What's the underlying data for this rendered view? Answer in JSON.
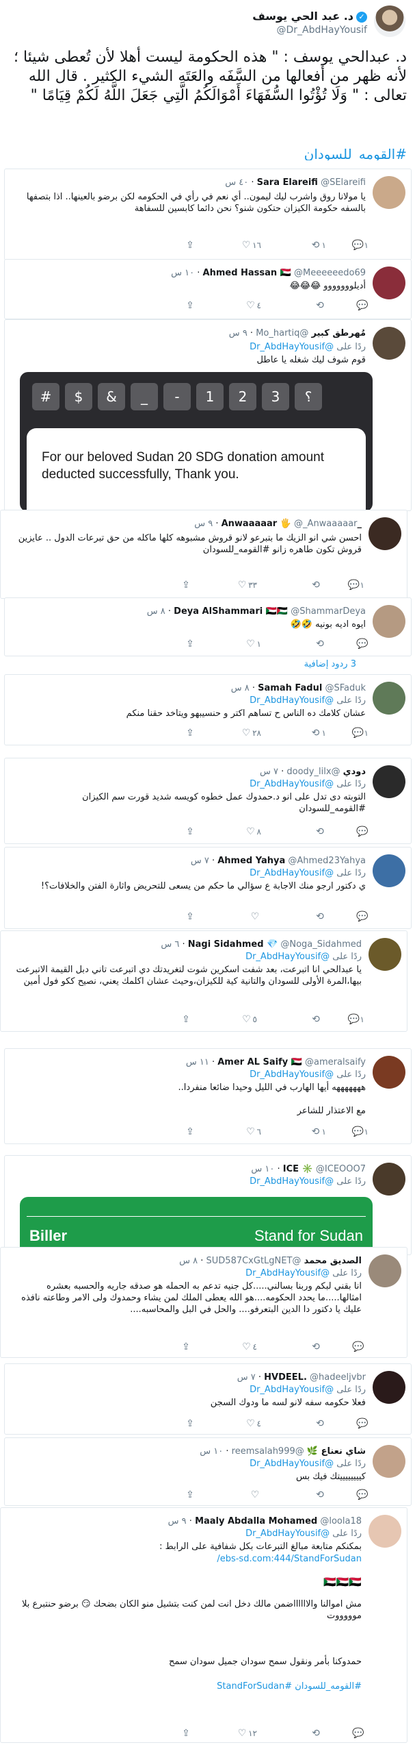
{
  "main": {
    "name": "د. عبد الحي يوسف",
    "handle": "@Dr_AbdHayYousif",
    "text": "د. عبدالحي يوسف : \" هذه الحكومة ليست أهلا لأن تُعطى شيئا ؛ لأنه ظهر من أفعالها من السَّفَه والعَتَه الشيء الكثير . قال الله تعالى : \" وَلَا تُؤْتُوا السُّفَهَاءَ أَمْوَالَكُمُ الَّتِي جَعَلَ اللَّهُ لَكُمْ قِيَامًا \"",
    "hashtag": "#القومه_للسودان"
  },
  "common": {
    "replying_prefix": "ردًا على",
    "mention": "@Dr_AbdHayYousif",
    "more_replies": "3 ردود إضافية"
  },
  "replies": [
    {
      "name": "Sara Elareifi",
      "handle": "@SElareifi",
      "time": "٤٠ س",
      "body": "يا مولانا روق واشرب ليك ليمون.. أي نعم في رأي في الحكومه لكن برضو بالعينها.. اذا بتصفها بالسفه حكومة الكيزان حتكون شنو؟ نحن دائما كابسين للسفاهة",
      "reply": "١",
      "retweet": "١",
      "like": "١٦"
    },
    {
      "name": "Ahmed Hassan 🇸🇩",
      "handle": "@Meeeeeedo69",
      "time": "١٠ س",
      "body": "أديلووووووو 😂😂😂",
      "reply": "",
      "retweet": "",
      "like": "٤"
    },
    {
      "name": "مُهرطق كبير",
      "handle": "@Mo_hartiq",
      "time": "٩ س",
      "body": "قوم شوف ليك شغله يا عاطل",
      "media_caption": "For our beloved Sudan 20 SDG donation amount deducted successfully, Thank you.",
      "keys": [
        "#",
        "$",
        "&",
        "_",
        "-",
        "1",
        "2",
        "3",
        "؟"
      ]
    },
    {
      "name": "_Anwaaaaar 🖐",
      "handle": "@_Anwaaaaar",
      "time": "٩ س",
      "body": "احسن شي انو الزيك ما بتبرعو لانو قروش مشبوهه كلها ماكله من حق تبرعات الدول .. عايزين قروش تكون طاهره زانو #القومه_للسودان",
      "reply": "١",
      "retweet": "",
      "like": "٣٣"
    },
    {
      "name": "Deya AlShammari 🇸🇩🇵🇸",
      "handle": "@ShammarDeya",
      "time": "٨ س",
      "body": "ايوه اديه بونيه 🤣🤣",
      "reply": "",
      "retweet": "",
      "like": "١"
    },
    {
      "name": "Samah Fadul",
      "handle": "@SFaduk",
      "time": "٨ س",
      "body": "عشان كلامك ده الناس ح تساهم اكتر و حنسيبهو ويتاخد حقنا منكم",
      "reply": "١",
      "retweet": "١",
      "like": "٢٨"
    },
    {
      "name": "دودي",
      "handle": "@doody_lilx",
      "time": "٧ س",
      "body": "التوبته دى تدل على انو د.حمدوك عمل خطوه كويسه شديد قورت سم الكيزان #القومه_للسودان",
      "reply": "",
      "retweet": "",
      "like": "٨"
    },
    {
      "name": "Ahmed Yahya",
      "handle": "@Ahmed23Yahya",
      "time": "٧ س",
      "body": "ي دكتور ارجو منك الاجابة ع سؤالي ما حكم من يسعى للتحريض واثارة الفتن والخلافات؟!",
      "reply": "",
      "retweet": "",
      "like": ""
    },
    {
      "name": "Nagi Sidahmed 💎",
      "handle": "@Noga_Sidahmed",
      "time": "٦ س",
      "body": "يا عبدالحي انا اتبرعت، بعد شفت اسكرين شوت لتغريدتك دي اتبرعت تاني دبل القيمة الاتبرعت بيها،المرة الأولى للسودان والتانية كية للكيزان،وحيث عشان اكلمك يعني، نصيح ككو فول أمين",
      "reply": "١",
      "retweet": "",
      "like": "٥"
    },
    {
      "name": "Amer AL Saify 🇸🇩",
      "handle": "@ameralsaify",
      "time": "١١ س",
      "body": "هههههههه أيها الهارب في الليل وحيدا ضائعا منفردا..",
      "body2": "مع الاعتذار للشاعر",
      "reply": "١",
      "retweet": "١",
      "like": "٦"
    },
    {
      "name": "ICE ✳️",
      "handle": "@ICEOOO7",
      "time": "١٠ س",
      "media_left": "Biller",
      "media_right": "Stand for Sudan"
    },
    {
      "name": "الصديق محمد",
      "handle": "@SUD587CxGtLgNET",
      "time": "٨ س",
      "body": "انا بقني لبكم وربنا بسالني.....كل جنيه تدعم به الحمله هو صدقه جاريه والحسبه بعشره امثالها.....ما يحدد الحكومه....هو الله يعطى الملك لمن يشاء وحمدوك ولى الامر وطاعته نافذه عليك يا دكتور دا الدين البتعرفو.... والحل في البل والمحاسبه....",
      "reply": "",
      "retweet": "",
      "like": "٤"
    },
    {
      "name": "HVDEEL.",
      "handle": "@hadeeljvbr",
      "time": "٧ س",
      "body": "فعلا حكومه سفه لانو لسه ما ودوك السجن",
      "reply": "",
      "retweet": "",
      "like": "٤"
    },
    {
      "name": "شاي نعناع 🌿",
      "handle": "@reemsalah999",
      "time": "١٠ س",
      "body": "كييييييييتك فيك بس",
      "reply": "",
      "retweet": "",
      "like": ""
    },
    {
      "name": "Maaly Abdalla Mohamed",
      "handle": "@loola18",
      "time": "٩ س",
      "body": "بمكنكم متابعة مبالغ التبرعات بكل شفافية على الرابط :",
      "link": "ebs-sd.com:444/StandForSudan/",
      "flags": "🇸🇩🇸🇩🇸🇩",
      "body2": "مش اموالنا والااااااضمن مالك دخل انت لمن كنت بتشيل منو الكان بضحك 😏 برضو حنتبرع بلا موووووت",
      "body3": "حمدوكنا بأمر ونقول سمح سودان جميل سودان سمح",
      "tags": "#القومه_للسودان #StandForSudan",
      "reply": "",
      "retweet": "",
      "like": "١٢"
    }
  ],
  "icons": {
    "reply": "speech-bubble",
    "retweet": "retweet-arrows",
    "like": "heart",
    "share": "share-arrow",
    "verified": "check-badge"
  },
  "colors": {
    "link": "#1b95e0",
    "muted": "#657786",
    "border": "#e1e8ed"
  }
}
